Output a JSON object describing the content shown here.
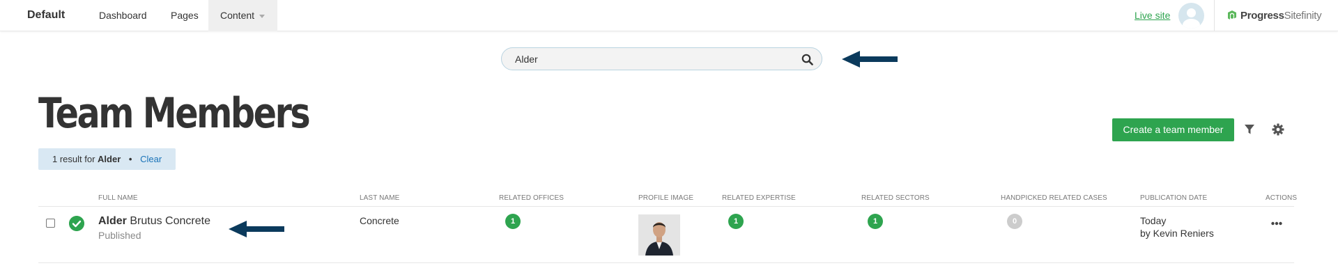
{
  "topbar": {
    "site_name": "Default",
    "nav": [
      {
        "label": "Dashboard"
      },
      {
        "label": "Pages"
      },
      {
        "label": "Content"
      }
    ],
    "live_site": "Live site",
    "brand_progress": "Progress",
    "brand_sitefinity": "Sitefinity"
  },
  "search": {
    "value": "Alder"
  },
  "page": {
    "title": "Team Members",
    "create_button": "Create a team member"
  },
  "result": {
    "prefix": "1 result for",
    "term": "Alder",
    "separator": "•",
    "clear": "Clear"
  },
  "table": {
    "columns": [
      "Full name",
      "Last name",
      "Related offices",
      "Profile image",
      "Related expertise",
      "Related sectors",
      "Handpicked related cases",
      "Publication date",
      "Actions"
    ],
    "rows": [
      {
        "title_bold": "Alder",
        "title_rest": "Brutus Concrete",
        "status": "Published",
        "last_name": "Concrete",
        "related_offices": "1",
        "related_expertise": "1",
        "related_sectors": "1",
        "handpicked_cases": "0",
        "date": "Today",
        "author": "by Kevin Reniers"
      }
    ]
  },
  "colors": {
    "accent_green": "#2ea44f",
    "arrow": "#0b3a5c",
    "pill_bg": "#d9e8f3",
    "link_blue": "#1a73b8"
  },
  "icons": [
    "search-icon",
    "filter-icon",
    "gear-icon",
    "check-icon",
    "more-icon",
    "user-avatar-icon",
    "progress-logo-icon",
    "arrow-left-icon"
  ]
}
